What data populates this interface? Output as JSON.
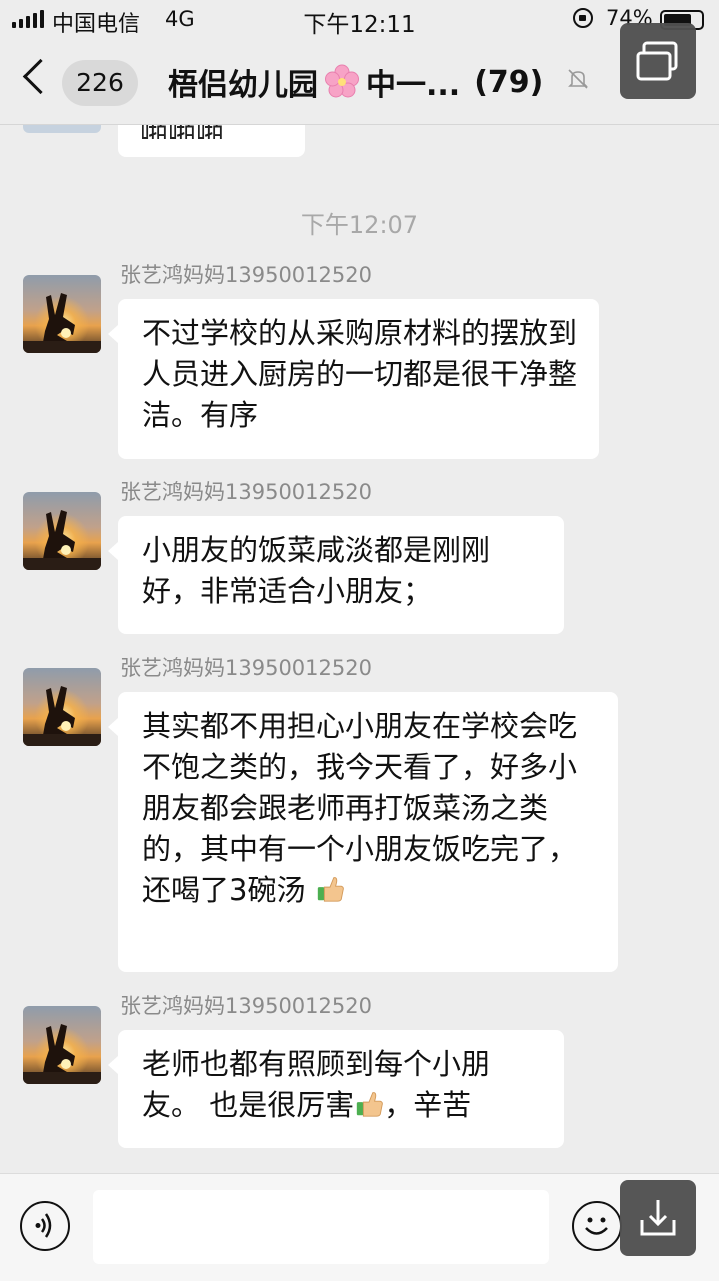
{
  "status_bar": {
    "carrier": "中国电信",
    "network": "4G",
    "time": "下午12:11",
    "battery_percent": "74%",
    "battery_level": 0.74
  },
  "nav": {
    "unread_count": "226",
    "title_part1": "梧侣幼儿园",
    "title_part2": "中一...",
    "member_count": "(79)"
  },
  "chat": {
    "previous_message_fragment": "啪啪啪",
    "timestamp": "下午12:07",
    "messages": [
      {
        "sender": "张艺鸿妈妈13950012520",
        "text": "不过学校的从采购原材料的摆放到人员进入厨房的一切都是很干净整洁。有序"
      },
      {
        "sender": "张艺鸿妈妈13950012520",
        "text": "小朋友的饭菜咸淡都是刚刚好，非常适合小朋友；"
      },
      {
        "sender": "张艺鸿妈妈13950012520",
        "text": "其实都不用担心小朋友在学校会吃不饱之类的，我今天看了，好多小朋友都会跟老师再打饭菜汤之类的，其中有一个小朋友饭吃完了，还喝了3碗汤",
        "suffix_icon": "thumbs-up"
      },
      {
        "sender": "张艺鸿妈妈13950012520",
        "text_before": "老师也都有照顾到每个小朋友。 也是很厉害",
        "inline_icon": "thumbs-up",
        "text_after": "，辛苦"
      }
    ]
  },
  "input": {
    "value": ""
  },
  "icons": {
    "back": "chevron-left-icon",
    "mute": "bell-mute-icon",
    "voice": "voice-icon",
    "emoji": "emoji-icon",
    "floating_top": "multi-window-icon",
    "floating_bottom": "download-icon"
  },
  "colors": {
    "background": "#ededed",
    "bubble": "#ffffff",
    "sender_text": "#8a8a8a",
    "timestamp_text": "#a8a8a8"
  }
}
